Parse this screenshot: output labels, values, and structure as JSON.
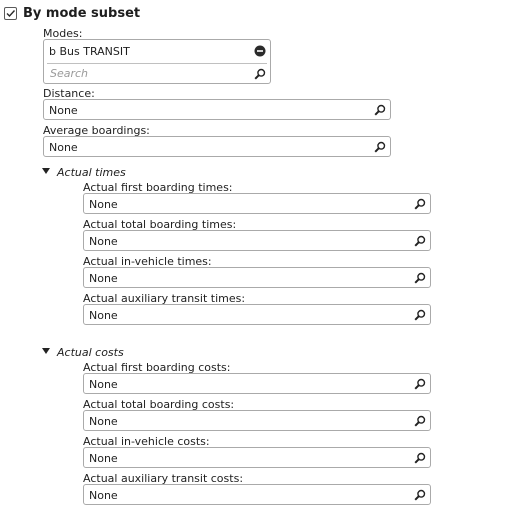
{
  "section": {
    "title": "By mode subset",
    "checked": true
  },
  "modes": {
    "label": "Modes:",
    "selected": [
      "b Bus TRANSIT"
    ],
    "search_placeholder": "Search"
  },
  "distance": {
    "label": "Distance:",
    "value": "None"
  },
  "avg_boardings": {
    "label": "Average boardings:",
    "value": "None"
  },
  "actual_times": {
    "title": "Actual times",
    "fields": [
      {
        "label": "Actual first boarding times:",
        "value": "None"
      },
      {
        "label": "Actual total boarding times:",
        "value": "None"
      },
      {
        "label": "Actual in-vehicle times:",
        "value": "None"
      },
      {
        "label": "Actual auxiliary transit times:",
        "value": "None"
      }
    ]
  },
  "actual_costs": {
    "title": "Actual costs",
    "fields": [
      {
        "label": "Actual first boarding costs:",
        "value": "None"
      },
      {
        "label": "Actual total boarding costs:",
        "value": "None"
      },
      {
        "label": "Actual in-vehicle costs:",
        "value": "None"
      },
      {
        "label": "Actual auxiliary transit costs:",
        "value": "None"
      }
    ]
  },
  "icons": {
    "search": "magnifier-icon",
    "remove": "remove-circle-icon",
    "expand": "triangle-down-icon",
    "check": "checkmark-icon"
  }
}
